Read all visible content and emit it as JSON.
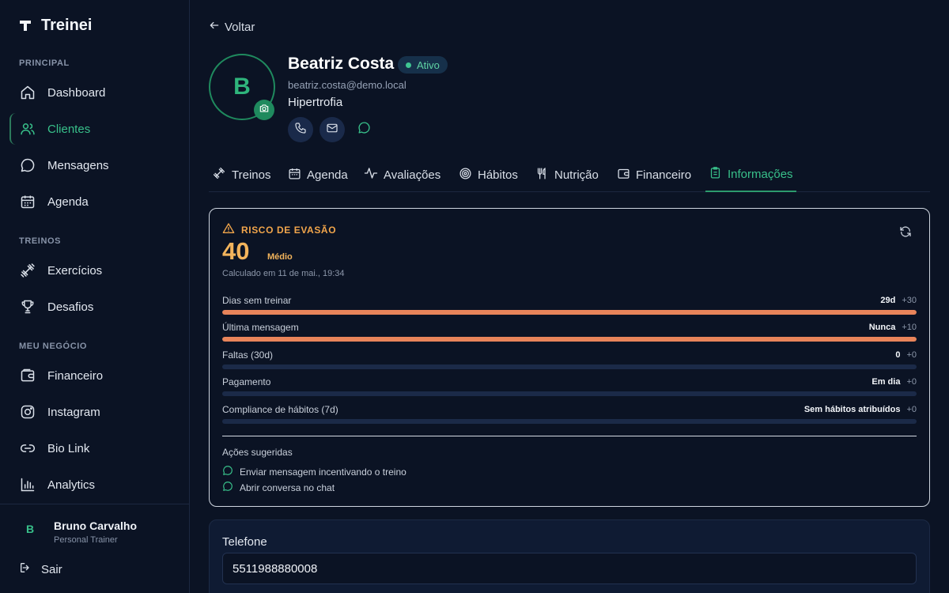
{
  "app": {
    "name": "Treinei"
  },
  "sidebar": {
    "sections": [
      {
        "label": "PRINCIPAL",
        "items": [
          {
            "label": "Dashboard",
            "icon": "home-icon"
          },
          {
            "label": "Clientes",
            "icon": "users-icon",
            "active": true
          },
          {
            "label": "Mensagens",
            "icon": "message-icon"
          },
          {
            "label": "Agenda",
            "icon": "calendar-icon"
          }
        ]
      },
      {
        "label": "TREINOS",
        "items": [
          {
            "label": "Exercícios",
            "icon": "dumbbell-icon"
          },
          {
            "label": "Desafios",
            "icon": "trophy-icon"
          }
        ]
      },
      {
        "label": "MEU NEGÓCIO",
        "items": [
          {
            "label": "Financeiro",
            "icon": "wallet-icon"
          },
          {
            "label": "Instagram",
            "icon": "instagram-icon"
          },
          {
            "label": "Bio Link",
            "icon": "link-icon"
          },
          {
            "label": "Analytics",
            "icon": "bar-chart-icon"
          }
        ]
      }
    ],
    "user": {
      "initial": "B",
      "name": "Bruno Carvalho",
      "role": "Personal Trainer"
    },
    "logout_label": "Sair"
  },
  "back_label": "Voltar",
  "client": {
    "initial": "B",
    "name": "Beatriz Costa",
    "status": "Ativo",
    "email": "beatriz.costa@demo.local",
    "goal": "Hipertrofia"
  },
  "tabs": [
    {
      "label": "Treinos",
      "icon": "dumbbell-icon"
    },
    {
      "label": "Agenda",
      "icon": "calendar-icon"
    },
    {
      "label": "Avaliações",
      "icon": "activity-icon"
    },
    {
      "label": "Hábitos",
      "icon": "target-icon"
    },
    {
      "label": "Nutrição",
      "icon": "utensils-icon"
    },
    {
      "label": "Financeiro",
      "icon": "wallet-icon"
    },
    {
      "label": "Informações",
      "icon": "clipboard-icon",
      "active": true
    }
  ],
  "risk": {
    "title": "RISCO DE EVASÃO",
    "score": "40",
    "level": "Médio",
    "calculated": "Calculado em 11 de mai., 19:34",
    "factors": [
      {
        "label": "Dias sem treinar",
        "value": "29d",
        "points": "+30",
        "fill": 1.0
      },
      {
        "label": "Última mensagem",
        "value": "Nunca",
        "points": "+10",
        "fill": 1.0
      },
      {
        "label": "Faltas (30d)",
        "value": "0",
        "points": "+0",
        "fill": 0
      },
      {
        "label": "Pagamento",
        "value": "Em dia",
        "points": "+0",
        "fill": 0
      },
      {
        "label": "Compliance de hábitos (7d)",
        "value": "Sem hábitos atribuídos",
        "points": "+0",
        "fill": 0
      }
    ],
    "actions_title": "Ações sugeridas",
    "actions": [
      "Enviar mensagem incentivando o treino",
      "Abrir conversa no chat"
    ]
  },
  "phone": {
    "label": "Telefone",
    "value": "5511988880008"
  },
  "colors": {
    "accent": "#38c08a",
    "warning": "#f3b45c",
    "bar": "#e8845a",
    "background": "#0b1324"
  }
}
